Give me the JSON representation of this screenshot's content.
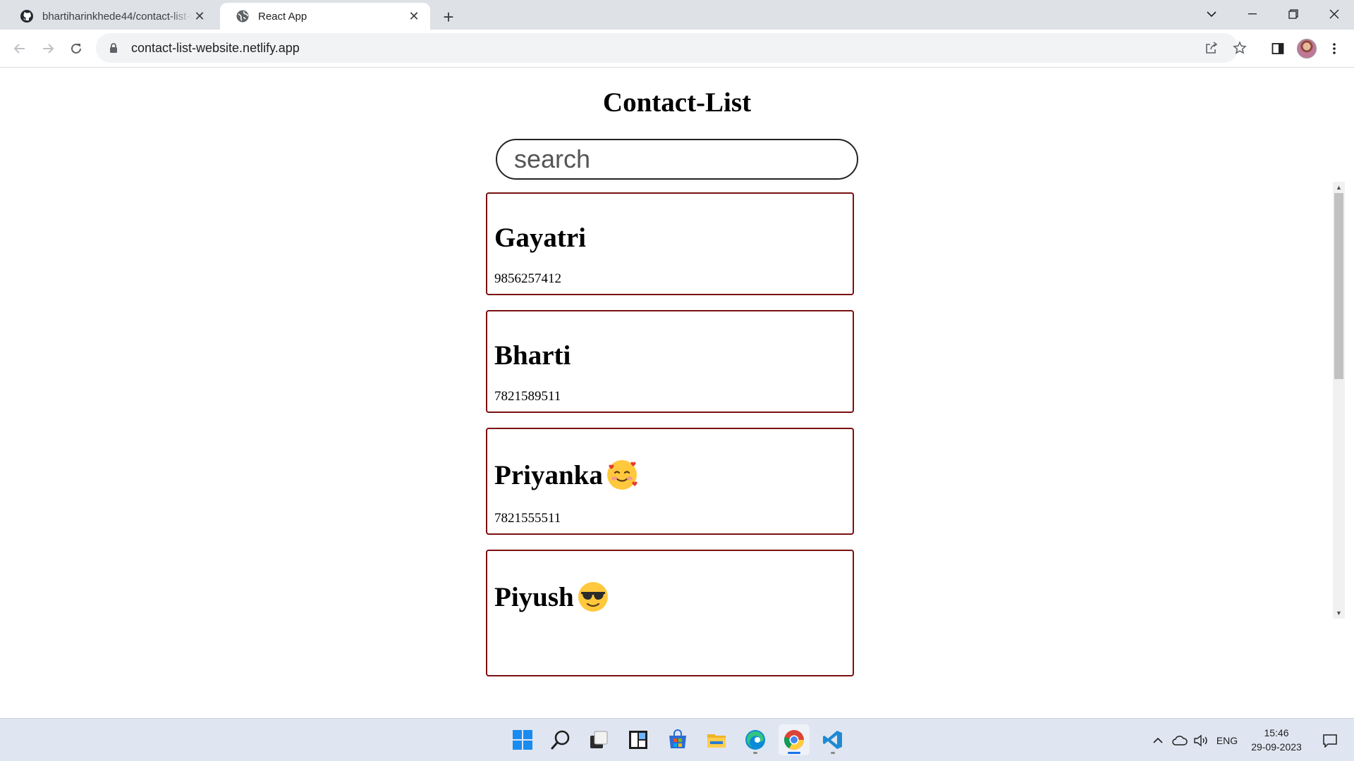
{
  "browser": {
    "tabs": [
      {
        "title": "bhartiharinkhede44/contact-list-website",
        "favicon": "github-icon",
        "active": false
      },
      {
        "title": "React App",
        "favicon": "globe-icon",
        "active": true
      }
    ],
    "url": "contact-list-website.netlify.app"
  },
  "page": {
    "title": "Contact-List",
    "search_placeholder": "search"
  },
  "contacts": [
    {
      "name": "Gayatri",
      "phone": "9856257412",
      "emoji": ""
    },
    {
      "name": "Bharti",
      "phone": "7821589511",
      "emoji": ""
    },
    {
      "name": "Priyanka",
      "phone": "7821555511",
      "emoji": "smiling-face-with-hearts"
    },
    {
      "name": "Piyush",
      "phone": "",
      "emoji": "smiling-face-with-sunglasses"
    }
  ],
  "taskbar": {
    "apps": [
      "windows-start-icon",
      "search-icon",
      "task-view-icon",
      "widgets-icon",
      "microsoft-store-icon",
      "file-explorer-icon",
      "edge-icon",
      "chrome-icon",
      "vscode-icon"
    ],
    "language": "ENG",
    "time": "15:46",
    "date": "29-09-2023"
  },
  "colors": {
    "card_border": "#7a1010",
    "tabstrip_bg": "#dee1e6",
    "taskbar_bg": "#dfe6f1"
  }
}
